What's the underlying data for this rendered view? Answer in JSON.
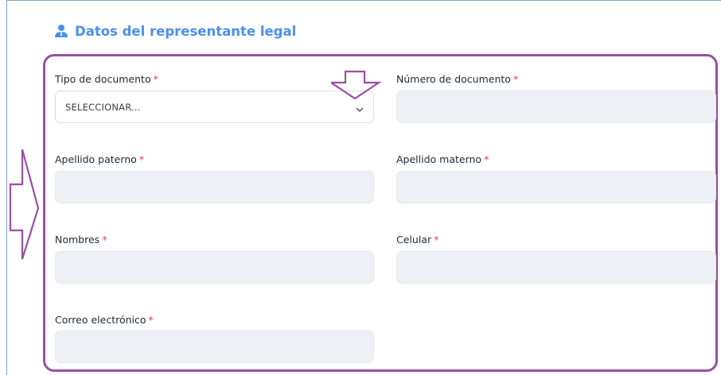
{
  "section": {
    "title": "Datos del representante legal",
    "icon": "user-icon",
    "accent_color": "#4b8ff0",
    "highlight_color": "#9b4ea6"
  },
  "form": {
    "required_marker": "*",
    "tipo_documento": {
      "label": "Tipo de documento",
      "value": "SELECCIONAR..."
    },
    "numero_documento": {
      "label": "Número de documento",
      "value": ""
    },
    "apellido_paterno": {
      "label": "Apellido paterno",
      "value": ""
    },
    "apellido_materno": {
      "label": "Apellido materno",
      "value": ""
    },
    "nombres": {
      "label": "Nombres",
      "value": ""
    },
    "celular": {
      "label": "Celular",
      "value": ""
    },
    "correo": {
      "label": "Correo electrónico",
      "value": ""
    }
  }
}
